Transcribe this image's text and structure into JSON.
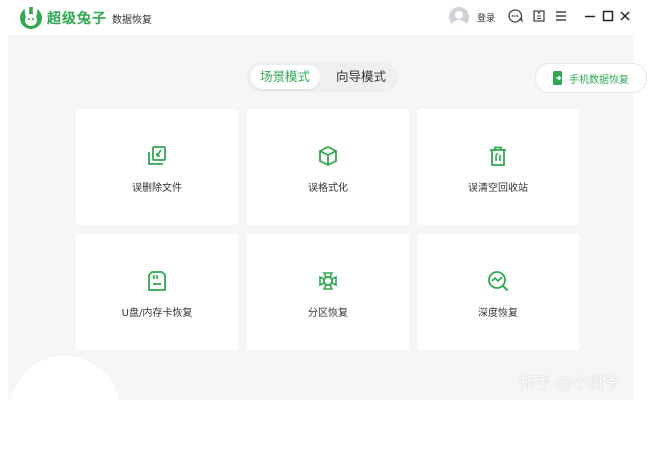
{
  "app": {
    "title": "超级兔子",
    "subtitle": "数据恢复"
  },
  "header": {
    "login_label": "登录"
  },
  "modes": {
    "tabs": [
      {
        "label": "场景模式",
        "active": true
      },
      {
        "label": "向导模式",
        "active": false
      }
    ]
  },
  "phone_recovery": {
    "label": "手机数据恢复"
  },
  "cards": [
    {
      "label": "误删除文件",
      "icon": "file-restore-icon"
    },
    {
      "label": "误格式化",
      "icon": "cube-icon"
    },
    {
      "label": "误清空回收站",
      "icon": "recycle-bin-icon"
    },
    {
      "label": "U盘/内存卡恢复",
      "icon": "sd-card-icon"
    },
    {
      "label": "分区恢复",
      "icon": "partition-icon"
    },
    {
      "label": "深度恢复",
      "icon": "deep-scan-icon"
    }
  ],
  "watermark": "知乎 @小斑爷",
  "colors": {
    "accent": "#2fa84f",
    "background": "#f5f6f7",
    "card": "#ffffff"
  }
}
